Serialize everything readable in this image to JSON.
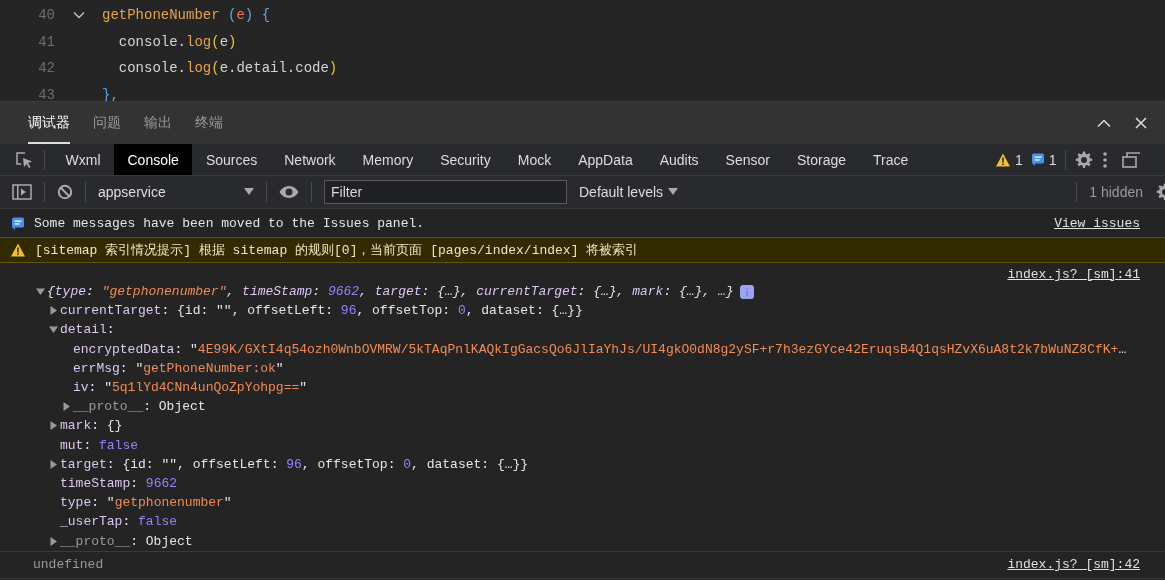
{
  "editor": {
    "lines": [
      {
        "number": "40",
        "fold_marker": true,
        "tokens": [
          {
            "kind": "fn",
            "text": "getPhoneNumber"
          },
          {
            "kind": "paren",
            "text": " ("
          },
          {
            "kind": "param",
            "text": "e"
          },
          {
            "kind": "paren",
            "text": ") {"
          }
        ]
      },
      {
        "number": "41",
        "fold_marker": false,
        "tokens": [
          {
            "kind": "plain",
            "text": "  console."
          },
          {
            "kind": "fn",
            "text": "log"
          },
          {
            "kind": "paren2",
            "text": "("
          },
          {
            "kind": "plain",
            "text": "e"
          },
          {
            "kind": "paren2",
            "text": ")"
          }
        ]
      },
      {
        "number": "42",
        "fold_marker": false,
        "tokens": [
          {
            "kind": "plain",
            "text": "  console."
          },
          {
            "kind": "fn",
            "text": "log"
          },
          {
            "kind": "paren2",
            "text": "("
          },
          {
            "kind": "plain",
            "text": "e.detail.code"
          },
          {
            "kind": "paren2",
            "text": ")"
          }
        ]
      },
      {
        "number": "43",
        "fold_marker": false,
        "tokens": [
          {
            "kind": "paren",
            "text": "},"
          }
        ]
      }
    ]
  },
  "panel_tabs": [
    {
      "label": "调试器",
      "selected": true
    },
    {
      "label": "问题",
      "selected": false
    },
    {
      "label": "输出",
      "selected": false
    },
    {
      "label": "终端",
      "selected": false
    }
  ],
  "devtools_tabs": [
    {
      "label": "Wxml",
      "selected": false
    },
    {
      "label": "Console",
      "selected": true
    },
    {
      "label": "Sources",
      "selected": false
    },
    {
      "label": "Network",
      "selected": false
    },
    {
      "label": "Memory",
      "selected": false
    },
    {
      "label": "Security",
      "selected": false
    },
    {
      "label": "Mock",
      "selected": false
    },
    {
      "label": "AppData",
      "selected": false
    },
    {
      "label": "Audits",
      "selected": false
    },
    {
      "label": "Sensor",
      "selected": false
    },
    {
      "label": "Storage",
      "selected": false
    },
    {
      "label": "Trace",
      "selected": false
    }
  ],
  "counts": {
    "warnings": "1",
    "infos": "1"
  },
  "toolbar": {
    "context": "appservice",
    "filter_placeholder": "Filter",
    "levels": "Default levels",
    "hidden": "1 hidden"
  },
  "messages": [
    {
      "kind": "info",
      "text": "Some messages have been moved to the Issues panel.",
      "link": "View issues"
    },
    {
      "kind": "warning",
      "text": "[sitemap 索引情况提示] 根据 sitemap 的规则[0]，当前页面 [pages/index/index] 将被索引"
    }
  ],
  "logs": [
    {
      "source": "index.js? [sm]:41",
      "info_badge": true,
      "tree": {
        "kind": "object",
        "expanded": true,
        "tokens": [
          {
            "kind": "punct",
            "text": "{"
          },
          {
            "kind": "key",
            "text": "type"
          },
          {
            "kind": "punct",
            "text": ": "
          },
          {
            "kind": "str",
            "text": "\"getphonenumber\""
          },
          {
            "kind": "punct",
            "text": ", "
          },
          {
            "kind": "key",
            "text": "timeStamp"
          },
          {
            "kind": "punct",
            "text": ": "
          },
          {
            "kind": "num",
            "text": "9662"
          },
          {
            "kind": "punct",
            "text": ", "
          },
          {
            "kind": "key",
            "text": "target"
          },
          {
            "kind": "punct",
            "text": ": {…}, "
          },
          {
            "kind": "key",
            "text": "currentTarget"
          },
          {
            "kind": "punct",
            "text": ": {…}, "
          },
          {
            "kind": "key",
            "text": "mark"
          },
          {
            "kind": "punct",
            "text": ": {…}, …}"
          }
        ],
        "children": [
          {
            "kind": "object",
            "expanded": false,
            "tokens": [
              {
                "kind": "key",
                "text": "currentTarget"
              },
              {
                "kind": "punct",
                "text": ": {id: \"\", offsetLeft: "
              },
              {
                "kind": "num",
                "text": "96"
              },
              {
                "kind": "punct",
                "text": ", offsetTop: "
              },
              {
                "kind": "num",
                "text": "0"
              },
              {
                "kind": "punct",
                "text": ", dataset: {…}}"
              }
            ]
          },
          {
            "kind": "object",
            "expanded": true,
            "tokens": [
              {
                "kind": "key",
                "text": "detail"
              },
              {
                "kind": "punct",
                "text": ":"
              }
            ],
            "children": [
              {
                "kind": "value",
                "tokens": [
                  {
                    "kind": "key",
                    "text": "encryptedData"
                  },
                  {
                    "kind": "punct",
                    "text": ": \""
                  },
                  {
                    "kind": "str",
                    "text": "4E99K/GXtI4q54ozh0WnbOVMRW/5kTAqPnlKAQkIgGacsQo6JlIaYhJs/UI4gkO0dN8g2ySF+r7h3ezGYce42EruqsB4Q1qsHZvX6uA8t2k7bWuNZ8CfK+"
                  },
                  {
                    "kind": "punct",
                    "text": "…"
                  }
                ]
              },
              {
                "kind": "value",
                "tokens": [
                  {
                    "kind": "key",
                    "text": "errMsg"
                  },
                  {
                    "kind": "punct",
                    "text": ": \""
                  },
                  {
                    "kind": "str",
                    "text": "getPhoneNumber:ok"
                  },
                  {
                    "kind": "punct",
                    "text": "\""
                  }
                ]
              },
              {
                "kind": "value",
                "tokens": [
                  {
                    "kind": "key",
                    "text": "iv"
                  },
                  {
                    "kind": "punct",
                    "text": ": \""
                  },
                  {
                    "kind": "str",
                    "text": "5q1lYd4CNn4unQoZpYohpg=="
                  },
                  {
                    "kind": "punct",
                    "text": "\""
                  }
                ]
              },
              {
                "kind": "object",
                "expanded": false,
                "tokens": [
                  {
                    "kind": "dim",
                    "text": "__proto__"
                  },
                  {
                    "kind": "punct",
                    "text": ": Object"
                  }
                ]
              }
            ]
          },
          {
            "kind": "object",
            "expanded": false,
            "tokens": [
              {
                "kind": "key",
                "text": "mark"
              },
              {
                "kind": "punct",
                "text": ": {}"
              }
            ]
          },
          {
            "kind": "value",
            "tokens": [
              {
                "kind": "key",
                "text": "mut"
              },
              {
                "kind": "punct",
                "text": ": "
              },
              {
                "kind": "num",
                "text": "false"
              }
            ]
          },
          {
            "kind": "object",
            "expanded": false,
            "tokens": [
              {
                "kind": "key",
                "text": "target"
              },
              {
                "kind": "punct",
                "text": ": {id: \"\", offsetLeft: "
              },
              {
                "kind": "num",
                "text": "96"
              },
              {
                "kind": "punct",
                "text": ", offsetTop: "
              },
              {
                "kind": "num",
                "text": "0"
              },
              {
                "kind": "punct",
                "text": ", dataset: {…}}"
              }
            ]
          },
          {
            "kind": "value",
            "tokens": [
              {
                "kind": "key",
                "text": "timeStamp"
              },
              {
                "kind": "punct",
                "text": ": "
              },
              {
                "kind": "num",
                "text": "9662"
              }
            ]
          },
          {
            "kind": "value",
            "tokens": [
              {
                "kind": "key",
                "text": "type"
              },
              {
                "kind": "punct",
                "text": ": \""
              },
              {
                "kind": "str",
                "text": "getphonenumber"
              },
              {
                "kind": "punct",
                "text": "\""
              }
            ]
          },
          {
            "kind": "value",
            "tokens": [
              {
                "kind": "key",
                "text": "_userTap"
              },
              {
                "kind": "punct",
                "text": ": "
              },
              {
                "kind": "num",
                "text": "false"
              }
            ]
          },
          {
            "kind": "object",
            "expanded": false,
            "tokens": [
              {
                "kind": "dim",
                "text": "__proto__"
              },
              {
                "kind": "punct",
                "text": ": Object"
              }
            ]
          }
        ]
      }
    },
    {
      "source": "index.js? [sm]:42",
      "value": "undefined"
    }
  ]
}
